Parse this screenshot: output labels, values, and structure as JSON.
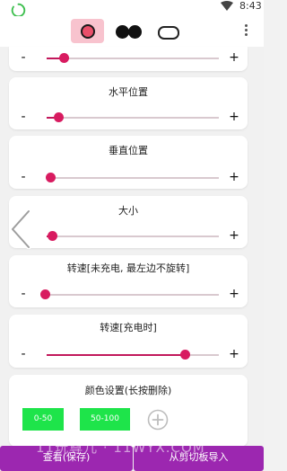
{
  "status_bar": {
    "time": "8:43",
    "icons": [
      "loading-indicator-icon",
      "wifi-icon"
    ]
  },
  "toolbar": {
    "tabs": [
      {
        "icon": "ring-icon",
        "selected": true
      },
      {
        "icon": "double-dot-icon",
        "selected": false
      },
      {
        "icon": "pill-icon",
        "selected": false
      }
    ],
    "more_icon": "more-vertical-icon"
  },
  "colors": {
    "accent": "#d81b60",
    "track": "#d9c9cf",
    "selected_tab_bg": "#f8c3ce",
    "swatch_green": "#1ee44a",
    "bottom_button": "#9c27b0"
  },
  "sliders": [
    {
      "id": "top_partial",
      "label": "",
      "minus": "-",
      "plus": "+",
      "value_fraction": 0.1
    },
    {
      "id": "horizontal",
      "label": "水平位置",
      "minus": "-",
      "plus": "+",
      "value_fraction": 0.07
    },
    {
      "id": "vertical",
      "label": "垂直位置",
      "minus": "-",
      "plus": "+",
      "value_fraction": 0.02
    },
    {
      "id": "size",
      "label": "大小",
      "minus": "-",
      "plus": "+",
      "value_fraction": 0.03
    },
    {
      "id": "speed_unplugged",
      "label": "转速[未充电, 最左边不旋转]",
      "minus": "-",
      "plus": "+",
      "value_fraction": 0.0
    },
    {
      "id": "speed_charging",
      "label": "转速[充电时]",
      "minus": "-",
      "plus": "+",
      "value_fraction": 0.8
    }
  ],
  "color_settings": {
    "title": "颜色设置(长按删除)",
    "swatches": [
      "0-50",
      "50-100"
    ],
    "add_icon": "add-circle-icon"
  },
  "bottom_buttons": {
    "view_save": "查看(保存)",
    "import_clipboard": "从剪切板导入"
  },
  "watermark": "11玩尊儿 · 11WYX.COM"
}
